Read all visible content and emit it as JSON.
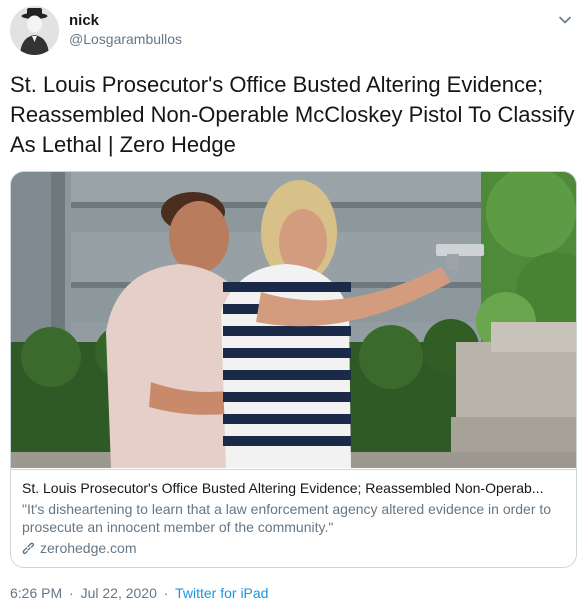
{
  "user": {
    "display_name": "nick",
    "handle": "@Losgarambullos",
    "avatar_icon": "avatar-figure-with-hat"
  },
  "menu_icon": "chevron-down-icon",
  "tweet_text": "St. Louis Prosecutor's Office Busted Altering Evidence; Reassembled Non-Operable McCloskey Pistol To Classify As Lethal | Zero Hedge",
  "card": {
    "title": "St. Louis Prosecutor's Office Busted Altering Evidence; Reassembled Non-Operab...",
    "description": "\"It's disheartening to learn that a law enforcement agency altered evidence in order to prosecute an innocent member of the community.\"",
    "domain": "zerohedge.com",
    "domain_icon": "link-icon"
  },
  "meta": {
    "time": "6:26 PM",
    "separator": "·",
    "date": "Jul 22, 2020",
    "source": "Twitter for iPad"
  },
  "colors": {
    "text": "#14171a",
    "secondary": "#657786",
    "link": "#1b95e0",
    "border": "#ccd6dd"
  }
}
